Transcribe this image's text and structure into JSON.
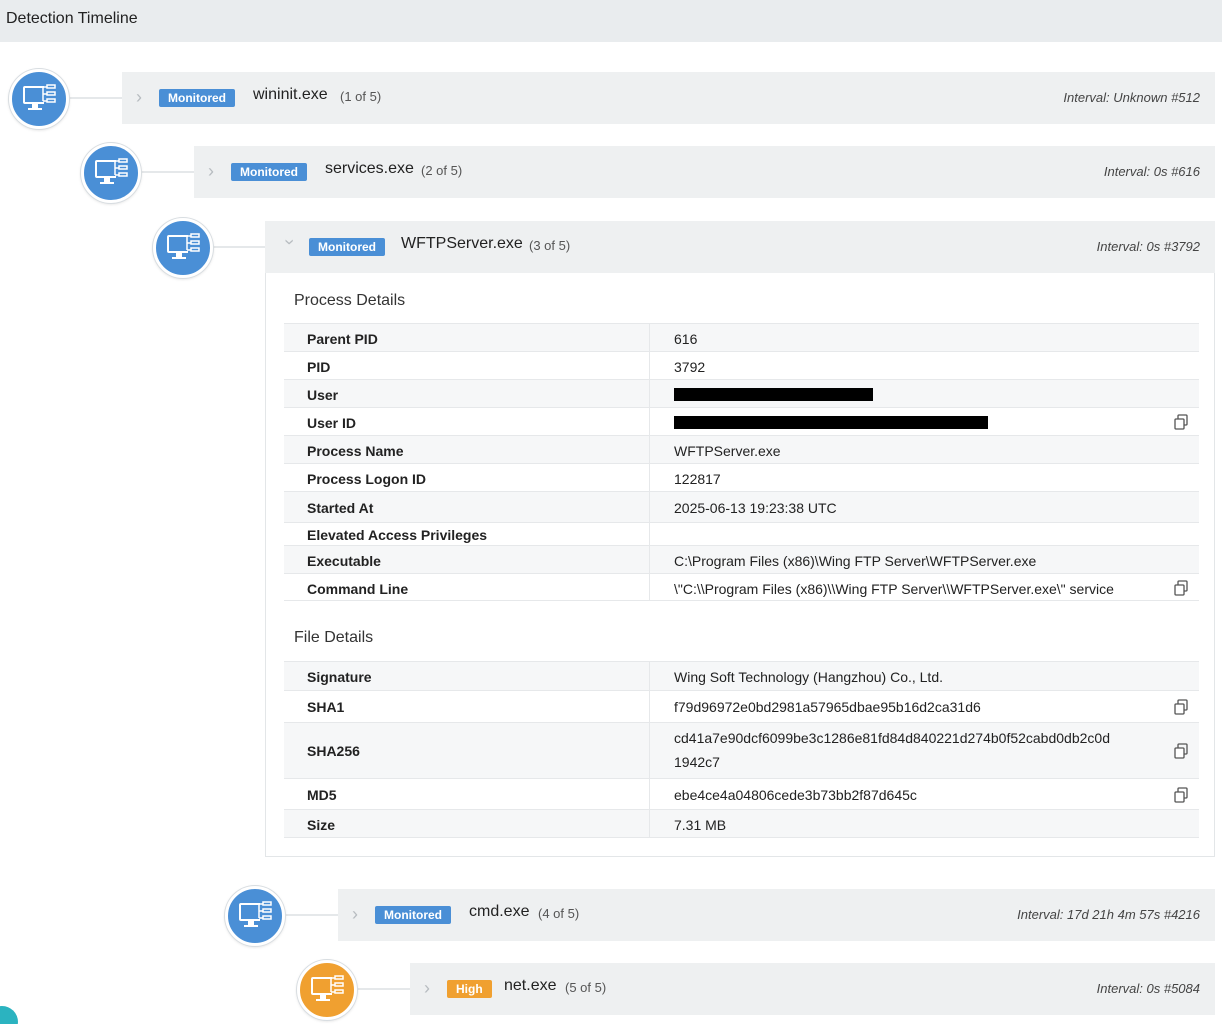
{
  "header": {
    "title": "Detection Timeline"
  },
  "timeline": [
    {
      "badge": "Monitored",
      "process": "wininit.exe",
      "count": "(1 of 5)",
      "interval": "Interval: Unknown #512",
      "severity": "monitored",
      "expanded": false
    },
    {
      "badge": "Monitored",
      "process": "services.exe",
      "count": "(2 of 5)",
      "interval": "Interval: 0s #616",
      "severity": "monitored",
      "expanded": false
    },
    {
      "badge": "Monitored",
      "process": "WFTPServer.exe",
      "count": "(3 of 5)",
      "interval": "Interval: 0s #3792",
      "severity": "monitored",
      "expanded": true
    },
    {
      "badge": "Monitored",
      "process": "cmd.exe",
      "count": "(4 of 5)",
      "interval": "Interval: 17d 21h 4m 57s #4216",
      "severity": "monitored",
      "expanded": false
    },
    {
      "badge": "High",
      "process": "net.exe",
      "count": "(5 of 5)",
      "interval": "Interval: 0s #5084",
      "severity": "high",
      "expanded": false
    }
  ],
  "process_details": {
    "title": "Process Details",
    "rows": [
      {
        "key": "Parent PID",
        "value": "616"
      },
      {
        "key": "PID",
        "value": "3792"
      },
      {
        "key": "User",
        "value": ""
      },
      {
        "key": "User ID",
        "value": ""
      },
      {
        "key": "Process Name",
        "value": "WFTPServer.exe"
      },
      {
        "key": "Process Logon ID",
        "value": "122817"
      },
      {
        "key": "Started At",
        "value": "2025-06-13 19:23:38 UTC"
      },
      {
        "key": "Elevated Access Privileges",
        "value": ""
      },
      {
        "key": "Executable",
        "value": "C:\\Program Files (x86)\\Wing FTP Server\\WFTPServer.exe"
      },
      {
        "key": "Command Line",
        "value": "\\\"C:\\\\Program Files (x86)\\\\Wing FTP Server\\\\WFTPServer.exe\\\" service"
      }
    ]
  },
  "file_details": {
    "title": "File Details",
    "rows": [
      {
        "key": "Signature",
        "value": "Wing Soft Technology (Hangzhou) Co., Ltd."
      },
      {
        "key": "SHA1",
        "value": "f79d96972e0bd2981a57965dbae95b16d2ca31d6"
      },
      {
        "key": "SHA256",
        "value": "cd41a7e90dcf6099be3c1286e81fd84d840221d274b0f52cabd0db2c0d",
        "value2": "1942c7"
      },
      {
        "key": "MD5",
        "value": "ebe4ce4a04806cede3b73bb2f87d645c"
      },
      {
        "key": "Size",
        "value": "7.31 MB"
      }
    ]
  },
  "colors": {
    "monitored": "#4a8fd6",
    "high": "#f0a030",
    "header_bg": "#e9ecee",
    "row_bg": "#eef0f1"
  },
  "icons": {
    "node": "computer-tree-icon",
    "expand": "chevron-right-icon",
    "collapse": "chevron-down-icon",
    "copy": "copy-icon"
  }
}
